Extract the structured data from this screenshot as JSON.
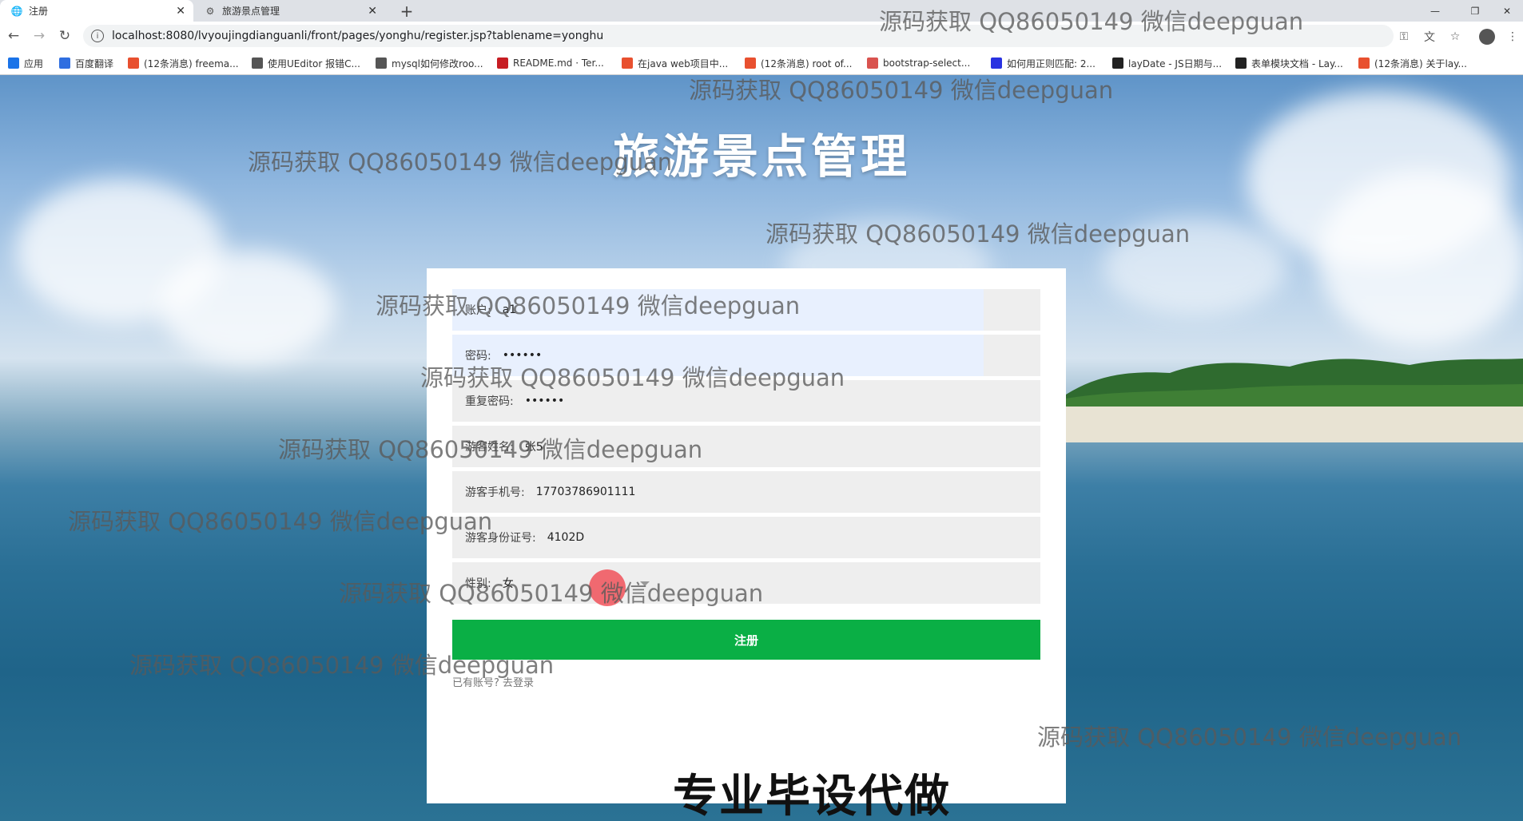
{
  "browser": {
    "tabs": [
      {
        "title": "注册",
        "active": true
      },
      {
        "title": "旅游景点管理",
        "active": false
      }
    ],
    "new_tab": "+",
    "url": "localhost:8080/lvyoujingdianguanli/front/pages/yonghu/register.jsp?tablename=yonghu",
    "bookmarks": [
      {
        "label": "应用",
        "icon": "apps-icon",
        "color": "#1a73e8"
      },
      {
        "label": "百度翻译",
        "icon": "baidu-translate-icon",
        "color": "#2f6ee0"
      },
      {
        "label": "(12条消息) freema...",
        "icon": "csdn-icon",
        "color": "#e8502f"
      },
      {
        "label": "使用UEditor 报错C...",
        "icon": "link-icon",
        "color": "#555555"
      },
      {
        "label": "mysql如何修改roo...",
        "icon": "link-icon",
        "color": "#555555"
      },
      {
        "label": "README.md · Ter...",
        "icon": "gitee-icon",
        "color": "#c71d23"
      },
      {
        "label": "在java web项目中...",
        "icon": "csdn-icon",
        "color": "#e8502f"
      },
      {
        "label": "(12条消息) root of...",
        "icon": "csdn-icon",
        "color": "#e8502f"
      },
      {
        "label": "bootstrap-select...",
        "icon": "bookmark-icon",
        "color": "#d9534f"
      },
      {
        "label": "如何用正则匹配: 2...",
        "icon": "baidu-icon",
        "color": "#2932e1"
      },
      {
        "label": "layDate - JS日期与...",
        "icon": "layui-icon",
        "color": "#222222"
      },
      {
        "label": "表单模块文档 - Lay...",
        "icon": "layui-icon",
        "color": "#222222"
      },
      {
        "label": "(12条消息) 关于lay...",
        "icon": "csdn-icon",
        "color": "#e8502f"
      }
    ]
  },
  "page": {
    "title": "旅游景点管理",
    "form": {
      "account": {
        "label": "账户:",
        "value": "a1"
      },
      "password": {
        "label": "密码:",
        "value": "••••••"
      },
      "repeat_password": {
        "label": "重复密码:",
        "value": "••••••"
      },
      "name": {
        "label": "游客姓名:",
        "value": "张5"
      },
      "phone": {
        "label": "游客手机号:",
        "value": "17703786901111"
      },
      "id_card": {
        "label": "游客身份证号:",
        "value": "4102D"
      },
      "gender": {
        "label": "性别:",
        "value": "女"
      },
      "submit": "注册",
      "login_link": "已有账号? 去登录"
    }
  },
  "watermark": {
    "text": "源码获取 QQ86050149 微信deepguan",
    "banner": "专业毕设代做"
  },
  "colors": {
    "register_button": "#0aaf45",
    "autofill_bg": "#e8f0fe",
    "field_bg": "#eeeeee"
  }
}
